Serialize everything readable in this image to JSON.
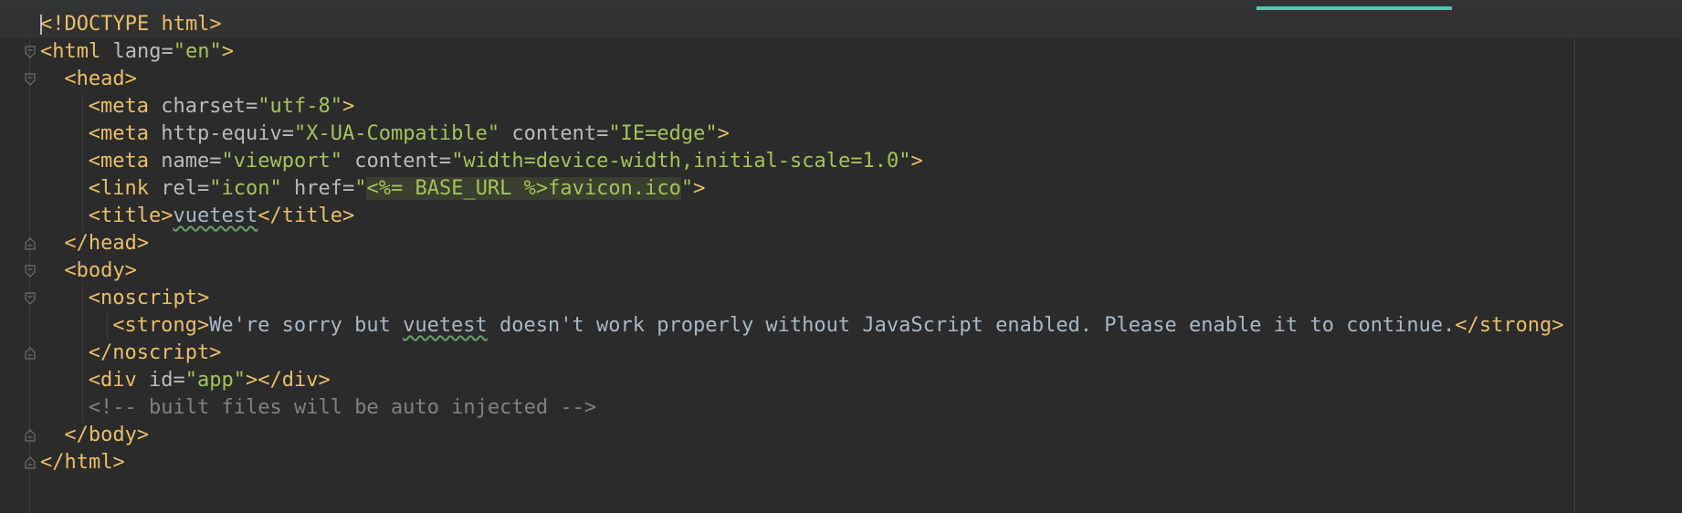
{
  "editor": {
    "lines": [
      {
        "parts": [
          {
            "c": "tag",
            "t": "<!DOCTYPE html>"
          }
        ],
        "indent": 0,
        "fold": "none",
        "current": true
      },
      {
        "parts": [
          {
            "c": "tag",
            "t": "<html "
          },
          {
            "c": "attr",
            "t": "lang="
          },
          {
            "c": "str",
            "t": "\"en\""
          },
          {
            "c": "tag",
            "t": ">"
          }
        ],
        "indent": 0,
        "fold": "open"
      },
      {
        "parts": [
          {
            "c": "tag",
            "t": "<head>"
          }
        ],
        "indent": 1,
        "fold": "open"
      },
      {
        "parts": [
          {
            "c": "tag",
            "t": "<meta "
          },
          {
            "c": "attr",
            "t": "charset="
          },
          {
            "c": "str",
            "t": "\"utf-8\""
          },
          {
            "c": "tag",
            "t": ">"
          }
        ],
        "indent": 2,
        "fold": "none"
      },
      {
        "parts": [
          {
            "c": "tag",
            "t": "<meta "
          },
          {
            "c": "attr",
            "t": "http-equiv="
          },
          {
            "c": "str",
            "t": "\"X-UA-Compatible\""
          },
          {
            "c": "attr",
            "t": " content="
          },
          {
            "c": "str",
            "t": "\"IE=edge\""
          },
          {
            "c": "tag",
            "t": ">"
          }
        ],
        "indent": 2,
        "fold": "none"
      },
      {
        "parts": [
          {
            "c": "tag",
            "t": "<meta "
          },
          {
            "c": "attr",
            "t": "name="
          },
          {
            "c": "str",
            "t": "\"viewport\""
          },
          {
            "c": "attr",
            "t": " content="
          },
          {
            "c": "str",
            "t": "\"width=device-width,initial-scale=1.0\""
          },
          {
            "c": "tag",
            "t": ">"
          }
        ],
        "indent": 2,
        "fold": "none"
      },
      {
        "parts": [
          {
            "c": "tag",
            "t": "<link "
          },
          {
            "c": "attr",
            "t": "rel="
          },
          {
            "c": "str",
            "t": "\"icon\""
          },
          {
            "c": "attr",
            "t": " href="
          },
          {
            "c": "str",
            "t": "\""
          },
          {
            "c": "str hl",
            "t": "<%= BASE_URL %>"
          },
          {
            "c": "str hl",
            "t": "favicon.ico"
          },
          {
            "c": "str",
            "t": "\""
          },
          {
            "c": "tag",
            "t": ">"
          }
        ],
        "indent": 2,
        "fold": "none"
      },
      {
        "parts": [
          {
            "c": "tag",
            "t": "<title>"
          },
          {
            "c": "txt typo",
            "t": "vuetest"
          },
          {
            "c": "tag",
            "t": "</title>"
          }
        ],
        "indent": 2,
        "fold": "none"
      },
      {
        "parts": [
          {
            "c": "tag",
            "t": "</head>"
          }
        ],
        "indent": 1,
        "fold": "close"
      },
      {
        "parts": [
          {
            "c": "tag",
            "t": "<body>"
          }
        ],
        "indent": 1,
        "fold": "open"
      },
      {
        "parts": [
          {
            "c": "tag",
            "t": "<noscript>"
          }
        ],
        "indent": 2,
        "fold": "open"
      },
      {
        "parts": [
          {
            "c": "tag",
            "t": "<strong>"
          },
          {
            "c": "txt",
            "t": "We're sorry but "
          },
          {
            "c": "txt typo",
            "t": "vuetest"
          },
          {
            "c": "txt",
            "t": " doesn't work properly without JavaScript enabled. Please enable it to continue."
          },
          {
            "c": "tag",
            "t": "</strong>"
          }
        ],
        "indent": 3,
        "fold": "none"
      },
      {
        "parts": [
          {
            "c": "tag",
            "t": "</noscript>"
          }
        ],
        "indent": 2,
        "fold": "close"
      },
      {
        "parts": [
          {
            "c": "tag",
            "t": "<div "
          },
          {
            "c": "attr",
            "t": "id="
          },
          {
            "c": "str",
            "t": "\"app\""
          },
          {
            "c": "tag",
            "t": "></div>"
          }
        ],
        "indent": 2,
        "fold": "none"
      },
      {
        "parts": [
          {
            "c": "comment",
            "t": "<!-- built files will be auto injected -->"
          }
        ],
        "indent": 2,
        "fold": "none"
      },
      {
        "parts": [
          {
            "c": "tag",
            "t": "</body>"
          }
        ],
        "indent": 1,
        "fold": "close"
      },
      {
        "parts": [
          {
            "c": "tag",
            "t": "</html>"
          }
        ],
        "indent": 0,
        "fold": "close"
      }
    ]
  },
  "colors": {
    "background": "#2b2b2b",
    "tag": "#e8bf6a",
    "attribute": "#bababa",
    "string": "#a5c25c",
    "text": "#a9b7c6",
    "comment": "#808080",
    "accent": "#4ec9b0"
  },
  "icons": {
    "fold_open": "fold-open-icon",
    "fold_close": "fold-close-icon"
  }
}
